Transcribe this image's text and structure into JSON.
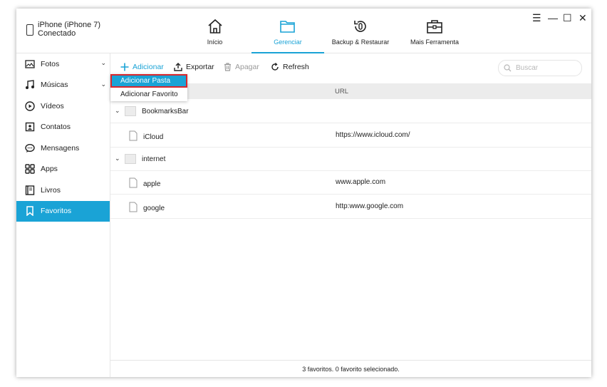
{
  "device": {
    "name_line1": "iPhone (iPhone 7)",
    "name_line2": "Conectado"
  },
  "nav": {
    "tabs": [
      {
        "label": "Início",
        "icon": "home-icon"
      },
      {
        "label": "Gerenciar",
        "icon": "folder-icon",
        "active": true
      },
      {
        "label": "Backup & Restaurar",
        "icon": "backup-restore-icon"
      },
      {
        "label": "Mais Ferramenta",
        "icon": "toolbox-icon"
      }
    ]
  },
  "window_controls": {
    "menu": "☰",
    "minimize": "—",
    "maximize": "☐",
    "close": "✕"
  },
  "sidebar": {
    "items": [
      {
        "label": "Fotos",
        "icon": "photo-icon",
        "has_chevron": true
      },
      {
        "label": "Músicas",
        "icon": "music-note-icon",
        "has_chevron": true
      },
      {
        "label": "Vídeos",
        "icon": "play-circle-icon"
      },
      {
        "label": "Contatos",
        "icon": "contact-card-icon"
      },
      {
        "label": "Mensagens",
        "icon": "message-bubble-icon"
      },
      {
        "label": "Apps",
        "icon": "apps-grid-icon"
      },
      {
        "label": "Livros",
        "icon": "book-icon"
      },
      {
        "label": "Favoritos",
        "icon": "bookmark-icon",
        "active": true
      }
    ],
    "chevron": "⌄"
  },
  "toolbar": {
    "add_label": "Adicionar",
    "export_label": "Exportar",
    "delete_label": "Apagar",
    "refresh_label": "Refresh",
    "search_placeholder": "Buscar"
  },
  "dropdown": {
    "items": [
      {
        "label": "Adicionar Pasta",
        "highlighted": true
      },
      {
        "label": "Adicionar Favorito"
      }
    ]
  },
  "table": {
    "headers": {
      "name": "",
      "url": "URL"
    },
    "rows": [
      {
        "type": "folder",
        "name": "BookmarksBar",
        "url": ""
      },
      {
        "type": "file",
        "name": "iCloud",
        "url": "https://www.icloud.com/"
      },
      {
        "type": "folder",
        "name": "internet",
        "url": ""
      },
      {
        "type": "file",
        "name": "apple",
        "url": "www.apple.com"
      },
      {
        "type": "file",
        "name": "google",
        "url": "http:www.google.com"
      }
    ]
  },
  "status": {
    "text": "3 favoritos. 0 favorito selecionado."
  },
  "colors": {
    "accent": "#1aa3d6",
    "highlight_border": "#d9262c"
  }
}
